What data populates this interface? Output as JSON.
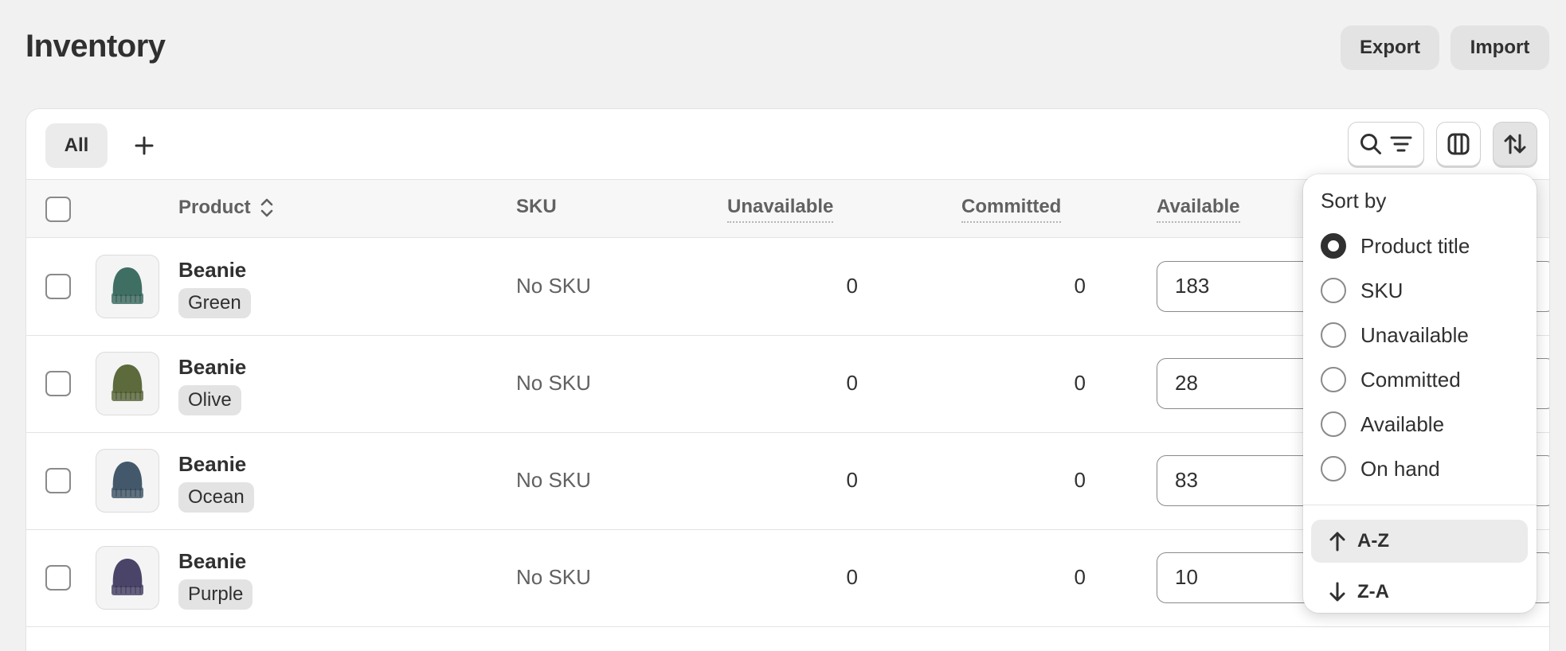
{
  "header": {
    "title": "Inventory",
    "export_label": "Export",
    "import_label": "Import"
  },
  "tabs": {
    "all_label": "All"
  },
  "table": {
    "columns": {
      "product": "Product",
      "sku": "SKU",
      "unavailable": "Unavailable",
      "committed": "Committed",
      "available": "Available"
    },
    "rows": [
      {
        "name": "Beanie",
        "variant": "Green",
        "sku": "No SKU",
        "unavailable": "0",
        "committed": "0",
        "available": "183",
        "color": "#3f6e63"
      },
      {
        "name": "Beanie",
        "variant": "Olive",
        "sku": "No SKU",
        "unavailable": "0",
        "committed": "0",
        "available": "28",
        "color": "#5c6a3c"
      },
      {
        "name": "Beanie",
        "variant": "Ocean",
        "sku": "No SKU",
        "unavailable": "0",
        "committed": "0",
        "available": "83",
        "color": "#43596b"
      },
      {
        "name": "Beanie",
        "variant": "Purple",
        "sku": "No SKU",
        "unavailable": "0",
        "committed": "0",
        "available": "10",
        "color": "#4a4468"
      }
    ]
  },
  "sort_popover": {
    "title": "Sort by",
    "options": [
      {
        "label": "Product title",
        "selected": true
      },
      {
        "label": "SKU",
        "selected": false
      },
      {
        "label": "Unavailable",
        "selected": false
      },
      {
        "label": "Committed",
        "selected": false
      },
      {
        "label": "Available",
        "selected": false
      },
      {
        "label": "On hand",
        "selected": false
      }
    ],
    "asc_label": "A-Z",
    "desc_label": "Z-A"
  }
}
